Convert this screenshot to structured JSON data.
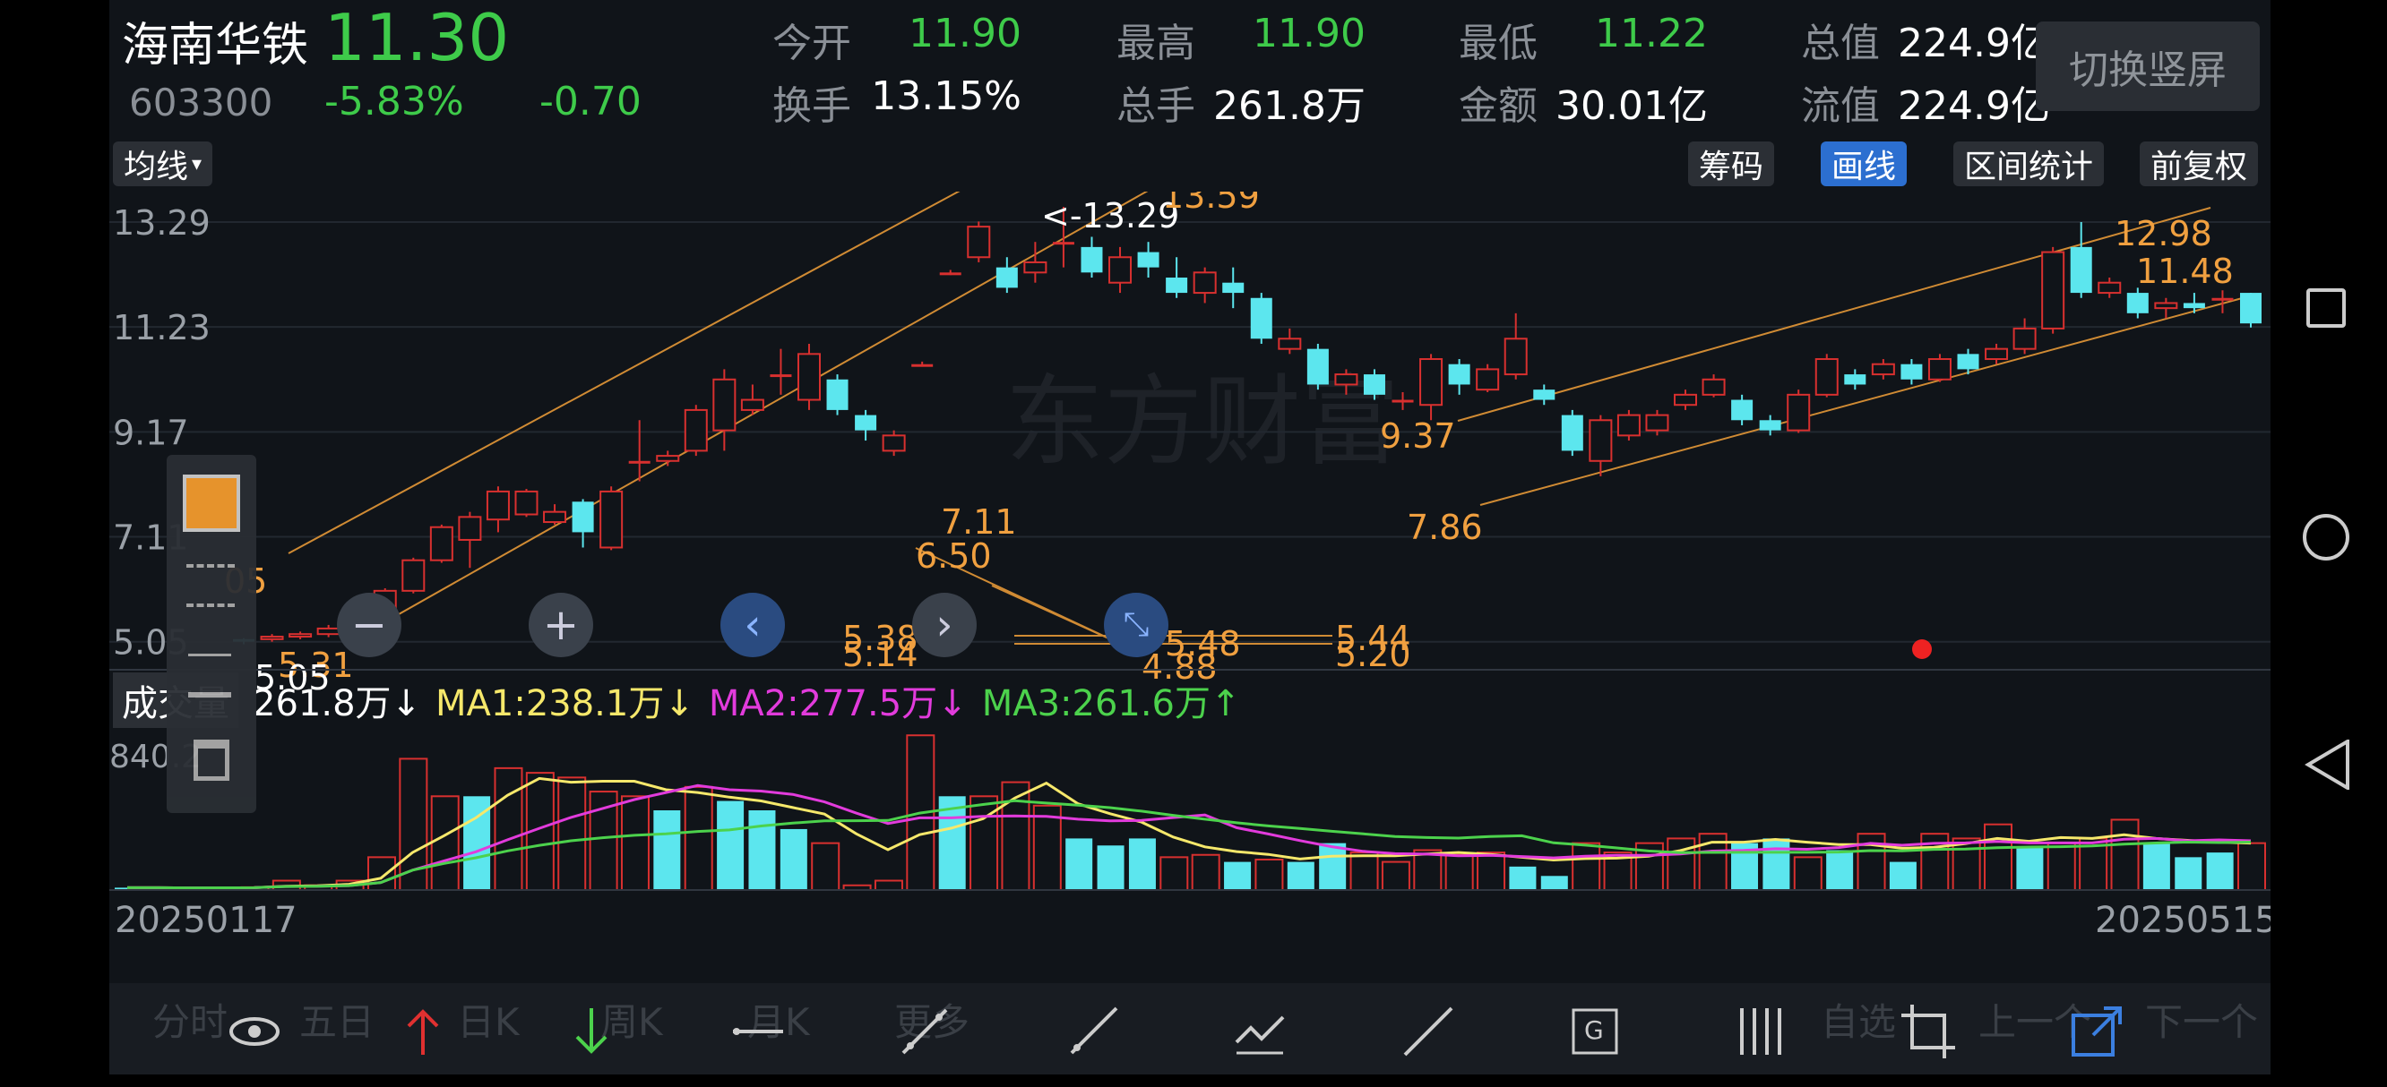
{
  "quote": {
    "name": "海南华铁",
    "price": "11.30",
    "code": "603300",
    "change_pct": "-5.83%",
    "change": "-0.70",
    "fields": [
      {
        "label": "今开",
        "value": "11.90",
        "color": "#3ecb4a"
      },
      {
        "label": "最高",
        "value": "11.90",
        "color": "#3ecb4a"
      },
      {
        "label": "最低",
        "value": "11.22",
        "color": "#3ecb4a"
      },
      {
        "label": "总值",
        "value": "224.9亿",
        "color": "#ffffff"
      },
      {
        "label": "换手",
        "value": "13.15%",
        "color": "#ffffff"
      },
      {
        "label": "总手",
        "value": "261.8万",
        "color": "#ffffff"
      },
      {
        "label": "金额",
        "value": "30.01亿",
        "color": "#ffffff"
      },
      {
        "label": "流值",
        "value": "224.9亿",
        "color": "#ffffff"
      }
    ],
    "switch_label": "切换竖屏"
  },
  "toolbar": {
    "ma_label": "均线",
    "chips": "筹码",
    "draw": "画线",
    "interval": "区间统计",
    "adjust": "前复权"
  },
  "price_axis": [
    "13.29",
    "11.23",
    "9.17",
    "7.11",
    "5.05"
  ],
  "annotations": [
    {
      "text": "<-13.29",
      "color": "#ffffff"
    },
    {
      "text": "13.59",
      "color": "#f0a040"
    },
    {
      "text": "12.98",
      "color": "#f0a040"
    },
    {
      "text": "11.48",
      "color": "#f0a040"
    },
    {
      "text": "9.37",
      "color": "#f0a040"
    },
    {
      "text": "7.86",
      "color": "#f0a040"
    },
    {
      "text": "7.11",
      "color": "#f0a040"
    },
    {
      "text": "6.50",
      "color": "#f0a040"
    },
    {
      "text": "5.48",
      "color": "#f0a040"
    },
    {
      "text": "5.44",
      "color": "#f0a040"
    },
    {
      "text": "5.38",
      "color": "#f0a040"
    },
    {
      "text": "5.31",
      "color": "#f0a040"
    },
    {
      "text": "5.20",
      "color": "#f0a040"
    },
    {
      "text": "5.14",
      "color": "#f0a040"
    },
    {
      "text": "4.88",
      "color": "#f0a040"
    },
    {
      "text": "5.05",
      "color": "#ffffff"
    },
    {
      "text": "05",
      "color": "#f0a040"
    }
  ],
  "volume": {
    "label": "成交量",
    "value": "261.8万↓",
    "ma1": "MA1:238.1万↓",
    "ma2": "MA2:277.5万↓",
    "ma3": "MA3:261.6万↑",
    "axis_top": "840.2"
  },
  "dates": {
    "start": "20250117",
    "end": "20250515"
  },
  "bottom_tabs": [
    "分时",
    "五日",
    "日K",
    "周K",
    "月K",
    "更多"
  ],
  "bottom_right": [
    "自选",
    "上一个",
    "下一个"
  ],
  "watermark": "东方财富",
  "chart_data": {
    "type": "candlestick",
    "candles": [
      [
        5.05,
        5.1,
        5.12,
        5.0,
        "down"
      ],
      [
        5.1,
        5.15,
        5.2,
        5.05,
        "up"
      ],
      [
        5.15,
        5.2,
        5.25,
        5.1,
        "up"
      ],
      [
        5.2,
        5.31,
        5.38,
        5.14,
        "up"
      ],
      [
        5.31,
        5.5,
        5.55,
        5.28,
        "up"
      ],
      [
        5.5,
        6.05,
        6.1,
        5.45,
        "up"
      ],
      [
        6.05,
        6.65,
        6.7,
        6.0,
        "up"
      ],
      [
        6.65,
        7.3,
        7.35,
        6.6,
        "up"
      ],
      [
        7.05,
        7.5,
        7.6,
        6.5,
        "up"
      ],
      [
        7.45,
        8.0,
        8.1,
        7.2,
        "up"
      ],
      [
        8.0,
        7.55,
        8.05,
        7.5,
        "up"
      ],
      [
        7.6,
        7.4,
        7.75,
        7.35,
        "up"
      ],
      [
        7.8,
        7.2,
        7.85,
        6.9,
        "down"
      ],
      [
        6.9,
        8.0,
        8.1,
        6.85,
        "up"
      ],
      [
        8.6,
        8.6,
        9.4,
        8.2,
        "flat"
      ],
      [
        8.6,
        8.7,
        8.8,
        8.5,
        "up"
      ],
      [
        8.8,
        9.6,
        9.7,
        8.7,
        "up"
      ],
      [
        9.2,
        10.2,
        10.4,
        8.8,
        "up"
      ],
      [
        9.8,
        9.6,
        10.1,
        9.5,
        "up"
      ],
      [
        10.3,
        10.3,
        10.8,
        9.9,
        "flat"
      ],
      [
        9.8,
        10.7,
        10.9,
        9.6,
        "up"
      ],
      [
        10.2,
        9.6,
        10.3,
        9.5,
        "down"
      ],
      [
        9.5,
        9.2,
        9.6,
        9.0,
        "down"
      ],
      [
        8.8,
        9.1,
        9.2,
        8.7,
        "up"
      ],
      [
        10.5,
        10.5,
        10.55,
        10.45,
        "flat"
      ],
      [
        12.3,
        12.3,
        12.35,
        12.25,
        "flat"
      ],
      [
        12.6,
        13.2,
        13.3,
        12.5,
        "up"
      ],
      [
        12.4,
        12.0,
        12.6,
        11.9,
        "down"
      ],
      [
        12.3,
        12.5,
        12.9,
        12.1,
        "up"
      ],
      [
        12.9,
        12.9,
        13.59,
        12.4,
        "flat"
      ],
      [
        12.8,
        12.3,
        13.0,
        12.2,
        "down"
      ],
      [
        12.1,
        12.6,
        12.8,
        11.9,
        "up"
      ],
      [
        12.7,
        12.4,
        12.9,
        12.2,
        "down"
      ],
      [
        12.2,
        11.9,
        12.6,
        11.8,
        "down"
      ],
      [
        11.9,
        12.3,
        12.4,
        11.7,
        "up"
      ],
      [
        12.1,
        11.9,
        12.4,
        11.6,
        "down"
      ],
      [
        11.8,
        11.0,
        11.9,
        10.9,
        "down"
      ],
      [
        11.0,
        10.8,
        11.2,
        10.7,
        "up"
      ],
      [
        10.8,
        10.1,
        10.9,
        10.0,
        "down"
      ],
      [
        10.1,
        10.3,
        10.4,
        9.9,
        "up"
      ],
      [
        10.3,
        9.9,
        10.4,
        9.8,
        "down"
      ],
      [
        9.8,
        9.8,
        9.95,
        9.6,
        "flat"
      ],
      [
        9.7,
        10.6,
        10.7,
        9.4,
        "up"
      ],
      [
        10.5,
        10.1,
        10.6,
        9.9,
        "down"
      ],
      [
        10.0,
        10.4,
        10.5,
        9.95,
        "up"
      ],
      [
        10.3,
        11.0,
        11.5,
        10.2,
        "up"
      ],
      [
        10.0,
        9.8,
        10.1,
        9.7,
        "down"
      ],
      [
        9.5,
        8.8,
        9.6,
        8.7,
        "down"
      ],
      [
        8.6,
        9.4,
        9.5,
        8.3,
        "up"
      ],
      [
        9.1,
        9.5,
        9.6,
        9.0,
        "up"
      ],
      [
        9.2,
        9.5,
        9.6,
        9.1,
        "up"
      ],
      [
        9.7,
        9.9,
        10.0,
        9.6,
        "up"
      ],
      [
        9.9,
        10.2,
        10.3,
        9.85,
        "up"
      ],
      [
        9.8,
        9.4,
        9.9,
        9.3,
        "down"
      ],
      [
        9.4,
        9.2,
        9.5,
        9.1,
        "down"
      ],
      [
        9.2,
        9.9,
        10.0,
        9.15,
        "up"
      ],
      [
        9.9,
        10.6,
        10.7,
        9.85,
        "up"
      ],
      [
        10.3,
        10.1,
        10.4,
        10.0,
        "down"
      ],
      [
        10.3,
        10.5,
        10.6,
        10.2,
        "up"
      ],
      [
        10.5,
        10.2,
        10.6,
        10.1,
        "down"
      ],
      [
        10.2,
        10.6,
        10.7,
        10.15,
        "up"
      ],
      [
        10.7,
        10.4,
        10.8,
        10.3,
        "down"
      ],
      [
        10.6,
        10.8,
        10.9,
        10.5,
        "up"
      ],
      [
        10.8,
        11.2,
        11.4,
        10.7,
        "up"
      ],
      [
        11.2,
        12.7,
        12.8,
        11.1,
        "up"
      ],
      [
        12.8,
        11.9,
        13.29,
        11.8,
        "down"
      ],
      [
        11.9,
        12.1,
        12.2,
        11.8,
        "up"
      ],
      [
        11.9,
        11.5,
        12.0,
        11.4,
        "down"
      ],
      [
        11.6,
        11.7,
        11.8,
        11.4,
        "up"
      ],
      [
        11.7,
        11.6,
        11.9,
        11.5,
        "down"
      ],
      [
        11.8,
        11.8,
        11.95,
        11.5,
        "flat"
      ],
      [
        11.9,
        11.3,
        11.9,
        11.22,
        "down"
      ]
    ],
    "volumes": [
      [
        5,
        "down"
      ],
      [
        5,
        "down"
      ],
      [
        4,
        "down"
      ],
      [
        5,
        "down"
      ],
      [
        6,
        "up"
      ],
      [
        20,
        "up"
      ],
      [
        10,
        "up"
      ],
      [
        20,
        "up"
      ],
      [
        70,
        "up"
      ],
      [
        280,
        "up"
      ],
      [
        200,
        "up"
      ],
      [
        200,
        "down"
      ],
      [
        260,
        "up"
      ],
      [
        250,
        "up"
      ],
      [
        240,
        "up"
      ],
      [
        210,
        "up"
      ],
      [
        200,
        "up"
      ],
      [
        170,
        "down"
      ],
      [
        220,
        "up"
      ],
      [
        190,
        "down"
      ],
      [
        170,
        "down"
      ],
      [
        130,
        "down"
      ],
      [
        100,
        "up"
      ],
      [
        10,
        "up"
      ],
      [
        20,
        "up"
      ],
      [
        330,
        "up"
      ],
      [
        200,
        "down"
      ],
      [
        200,
        "up"
      ],
      [
        230,
        "up"
      ],
      [
        180,
        "up"
      ],
      [
        110,
        "down"
      ],
      [
        95,
        "down"
      ],
      [
        110,
        "down"
      ],
      [
        70,
        "up"
      ],
      [
        75,
        "up"
      ],
      [
        60,
        "down"
      ],
      [
        65,
        "up"
      ],
      [
        60,
        "down"
      ],
      [
        100,
        "down"
      ],
      [
        80,
        "up"
      ],
      [
        60,
        "up"
      ],
      [
        85,
        "up"
      ],
      [
        75,
        "up"
      ],
      [
        80,
        "up"
      ],
      [
        50,
        "down"
      ],
      [
        30,
        "down"
      ],
      [
        100,
        "up"
      ],
      [
        80,
        "up"
      ],
      [
        100,
        "up"
      ],
      [
        110,
        "up"
      ],
      [
        120,
        "up"
      ],
      [
        100,
        "down"
      ],
      [
        110,
        "down"
      ],
      [
        70,
        "up"
      ],
      [
        85,
        "down"
      ],
      [
        120,
        "up"
      ],
      [
        60,
        "down"
      ],
      [
        120,
        "up"
      ],
      [
        110,
        "up"
      ],
      [
        140,
        "up"
      ],
      [
        90,
        "down"
      ],
      [
        100,
        "up"
      ],
      [
        110,
        "up"
      ],
      [
        150,
        "up"
      ],
      [
        100,
        "down"
      ],
      [
        70,
        "down"
      ],
      [
        80,
        "down"
      ],
      [
        100,
        "up"
      ]
    ],
    "ylim": [
      4.5,
      13.8
    ]
  }
}
